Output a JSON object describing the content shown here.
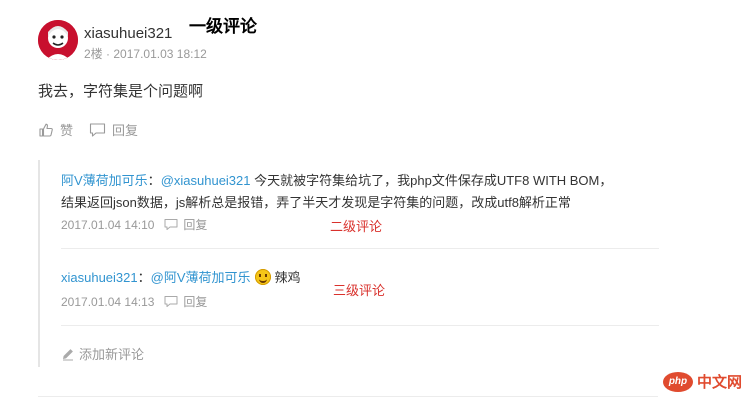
{
  "comment": {
    "username": "xiasuhuei321",
    "floor": "2楼",
    "separator": "·",
    "time": "2017.01.03 18:12",
    "content": "我去，字符集是个问题啊",
    "like_label": "赞",
    "reply_label": "回复",
    "annotation": "一级评论"
  },
  "replies": [
    {
      "author": "阿V薄荷加可乐",
      "colon": "：",
      "mention": "@xiasuhuei321",
      "text_line1": "今天就被字符集给坑了，我php文件保存成UTF8 WITH BOM，",
      "text_line2": "结果返回json数据，js解析总是报错，弄了半天才发现是字符集的问题，改成utf8解析正常",
      "time": "2017.01.04 14:10",
      "reply_label": "回复",
      "annotation": "二级评论"
    },
    {
      "author": "xiasuhuei321",
      "colon": "：",
      "mention": "@阿V薄荷加可乐",
      "emoji": "smiley-face",
      "text": "辣鸡",
      "time": "2017.01.04 14:13",
      "reply_label": "回复",
      "annotation": "三级评论"
    }
  ],
  "add_comment_label": "添加新评论",
  "watermark": {
    "badge": "php",
    "text": "中文网"
  },
  "colors": {
    "link": "#3194d0",
    "annotation_red": "#d9312c",
    "muted": "#999999"
  }
}
